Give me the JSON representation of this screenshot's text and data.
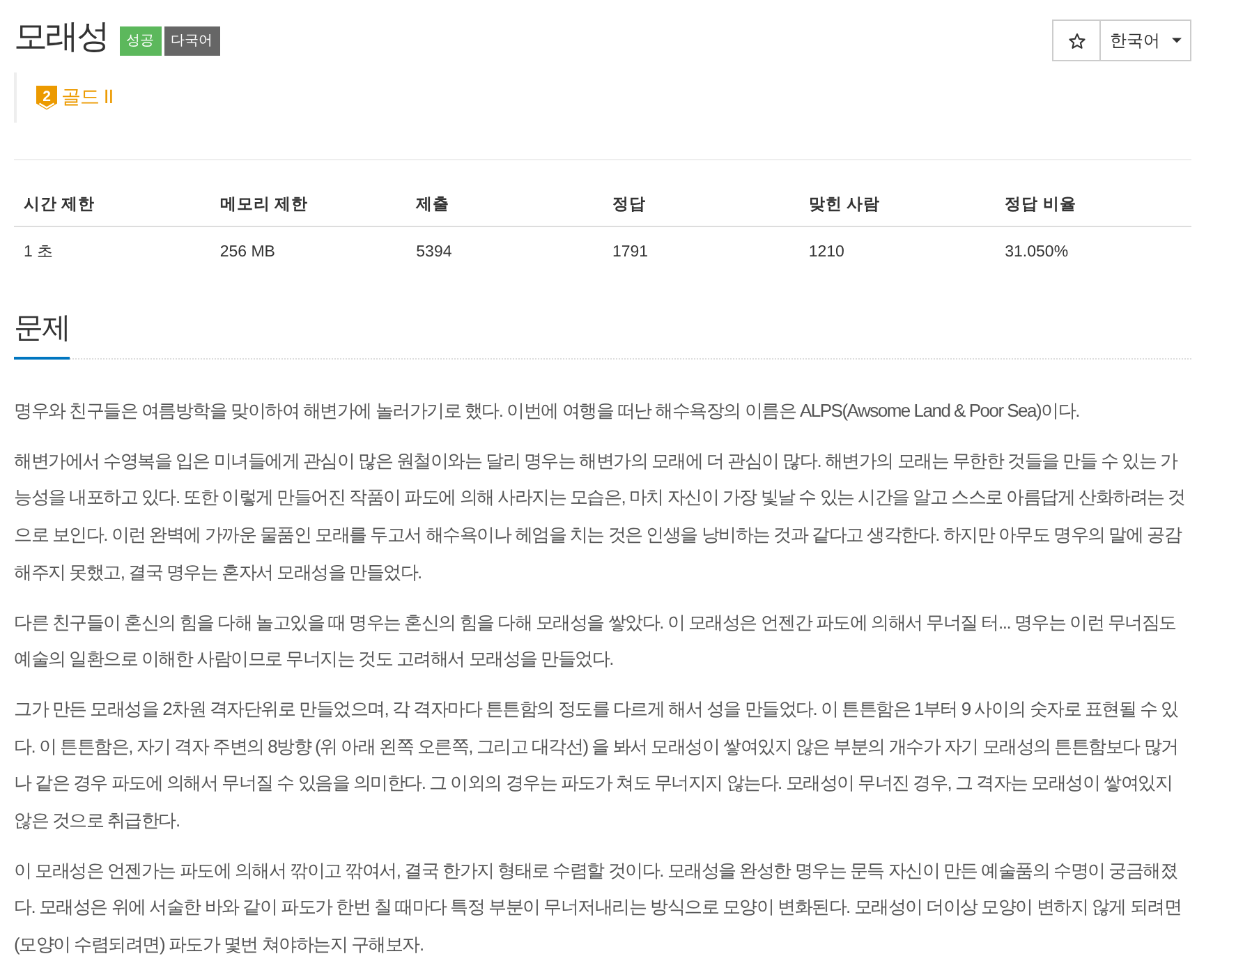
{
  "title": "모래성",
  "badges": [
    {
      "label": "성공",
      "color": "#5cb85c"
    },
    {
      "label": "다국어",
      "color": "#666666"
    }
  ],
  "tier": {
    "number": "2",
    "label": "골드 II"
  },
  "toolbar": {
    "favorite_selected": false,
    "language": "한국어"
  },
  "table": {
    "columns": [
      "시간 제한",
      "메모리 제한",
      "제출",
      "정답",
      "맞힌 사람",
      "정답 비율"
    ],
    "rows": [
      [
        "1 초",
        "256 MB",
        "5394",
        "1791",
        "1210",
        "31.050%"
      ]
    ]
  },
  "section": {
    "heading": "문제",
    "paragraphs": [
      "명우와 친구들은 여름방학을 맞이하여 해변가에 놀러가기로 했다. 이번에 여행을 떠난 해수욕장의 이름은 ALPS(Awsome Land & Poor Sea)이다.",
      "해변가에서 수영복을 입은 미녀들에게 관심이 많은 원철이와는 달리 명우는 해변가의 모래에 더 관심이 많다. 해변가의 모래는 무한한 것들을 만들 수 있는 가능성을 내포하고 있다. 또한 이렇게 만들어진 작품이 파도에 의해 사라지는 모습은, 마치 자신이 가장 빛날 수 있는 시간을 알고 스스로 아름답게 산화하려는 것으로 보인다. 이런 완벽에 가까운 물품인 모래를 두고서 해수욕이나 헤엄을 치는 것은 인생을 낭비하는 것과 같다고 생각한다. 하지만 아무도 명우의 말에 공감해주지 못했고, 결국 명우는 혼자서 모래성을 만들었다.",
      "다른 친구들이 혼신의 힘을 다해 놀고있을 때 명우는 혼신의 힘을 다해 모래성을 쌓았다. 이 모래성은 언젠간 파도에 의해서 무너질 터... 명우는 이런 무너짐도 예술의 일환으로 이해한 사람이므로 무너지는 것도 고려해서 모래성을 만들었다.",
      "그가 만든 모래성을 2차원 격자단위로 만들었으며, 각 격자마다 튼튼함의 정도를 다르게 해서 성을 만들었다. 이 튼튼함은 1부터 9 사이의 숫자로 표현될 수 있다. 이 튼튼함은, 자기 격자 주변의 8방향 (위 아래 왼쪽 오른쪽, 그리고 대각선) 을 봐서 모래성이 쌓여있지 않은 부분의 개수가 자기 모래성의 튼튼함보다 많거나 같은 경우 파도에 의해서 무너질 수 있음을 의미한다. 그 이외의 경우는 파도가 쳐도 무너지지 않는다. 모래성이 무너진 경우, 그 격자는 모래성이 쌓여있지 않은 것으로 취급한다.",
      "이 모래성은 언젠가는 파도에 의해서 깎이고 깎여서, 결국 한가지 형태로 수렴할 것이다. 모래성을 완성한 명우는 문득 자신이 만든 예술품의 수명이 궁금해졌다. 모래성은 위에 서술한 바와 같이 파도가 한번 칠 때마다 특정 부분이 무너저내리는 방식으로 모양이 변화된다. 모래성이 더이상 모양이 변하지 않게 되려면 (모양이 수렴되려면) 파도가 몇번 쳐야하는지 구해보자."
    ]
  }
}
